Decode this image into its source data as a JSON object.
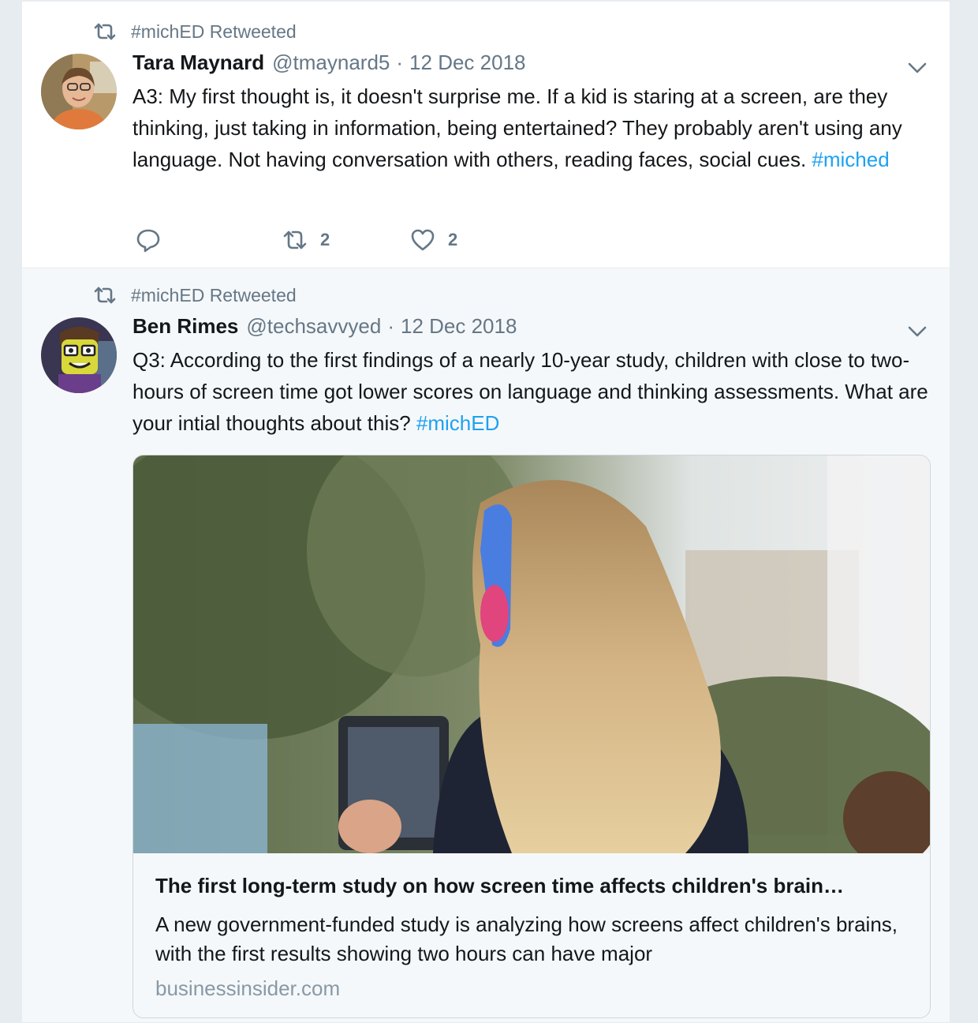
{
  "colors": {
    "accent": "#1da1f2",
    "secondary_text": "#657786",
    "primary_text": "#14171a",
    "background": "#e6ecf0"
  },
  "tweets": [
    {
      "retweet_context": "#michED Retweeted",
      "retweet_icon": "retweet-icon",
      "author": {
        "name": "Tara Maynard",
        "handle": "@tmaynard5",
        "avatar": "avatar-photo"
      },
      "separator": "·",
      "timestamp": "12 Dec 2018",
      "text": "A3: My first thought is, it doesn't surprise me.  If a kid is staring at a screen, are they thinking, just taking in information, being entertained? They probably aren't using any language.  Not having conversation with others, reading faces, social cues. ",
      "hashtag": "#miched",
      "caret_icon": "chevron-down-icon",
      "actions": {
        "reply_icon": "reply-icon",
        "retweet_icon": "retweet-icon",
        "retweet_count": "2",
        "like_icon": "heart-icon",
        "like_count": "2"
      }
    },
    {
      "retweet_context": "#michED Retweeted",
      "retweet_icon": "retweet-icon",
      "author": {
        "name": "Ben Rimes",
        "handle": "@techsavvyed",
        "avatar": "avatar-cartoon"
      },
      "separator": "·",
      "timestamp": "12 Dec 2018",
      "text": "Q3: According to the first findings of a nearly 10-year study, children with close to two-hours of screen time got lower scores on language and thinking assessments. What are your intial thoughts about this? ",
      "hashtag": "#michED",
      "caret_icon": "chevron-down-icon",
      "card": {
        "image": "child-with-tablet-photo",
        "title": "The first long-term study on how screen time affects children's brain…",
        "description": "A new government-funded study is analyzing how screens affect children's brains, with the first results showing two hours can have major",
        "domain": "businessinsider.com"
      }
    }
  ]
}
